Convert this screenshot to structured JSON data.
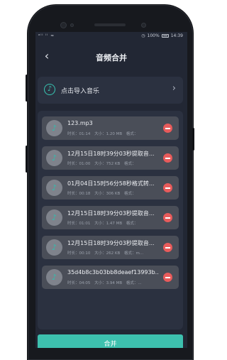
{
  "status_bar": {
    "signal": "ᵃˡˡ ˡˡ ≈",
    "battery_percent": "100%",
    "time": "14:39"
  },
  "header": {
    "back_icon": "chevron-left-icon",
    "title": "音频合并"
  },
  "import_row": {
    "icon": "music-note-icon",
    "label": "点击导入音乐",
    "chevron": "chevron-right-icon"
  },
  "files": [
    {
      "name": "123.mp3",
      "duration_label": "时长：01:14",
      "size_label": "大小：1.20 MB",
      "format_label": "格式："
    },
    {
      "name": "12月15日18时39分03秒提取音...",
      "duration_label": "时长：01:00",
      "size_label": "大小：752 KB",
      "format_label": "格式："
    },
    {
      "name": "01月04日15时56分58秒格式转...",
      "duration_label": "时长：00:18",
      "size_label": "大小：306 KB",
      "format_label": "格式："
    },
    {
      "name": "12月15日18时39分03秒提取音...",
      "duration_label": "时长：01:01",
      "size_label": "大小：1.47 MB",
      "format_label": "格式："
    },
    {
      "name": "12月15日18时39分03秒提取音...",
      "duration_label": "时长：00:10",
      "size_label": "大小：262 KB",
      "format_label": "格式：m..."
    },
    {
      "name": "35d4b8c3b03bb8deaef13993b...",
      "duration_label": "时长：04:05",
      "size_label": "大小：3.94 MB",
      "format_label": "格式：..."
    }
  ],
  "merge_button": {
    "label": "合并"
  },
  "colors": {
    "screen_bg": "#222734",
    "panel_bg": "#2b3140",
    "item_bg": "#4a4e58",
    "accent": "#3dc0ae",
    "delete": "#e85b5b"
  }
}
